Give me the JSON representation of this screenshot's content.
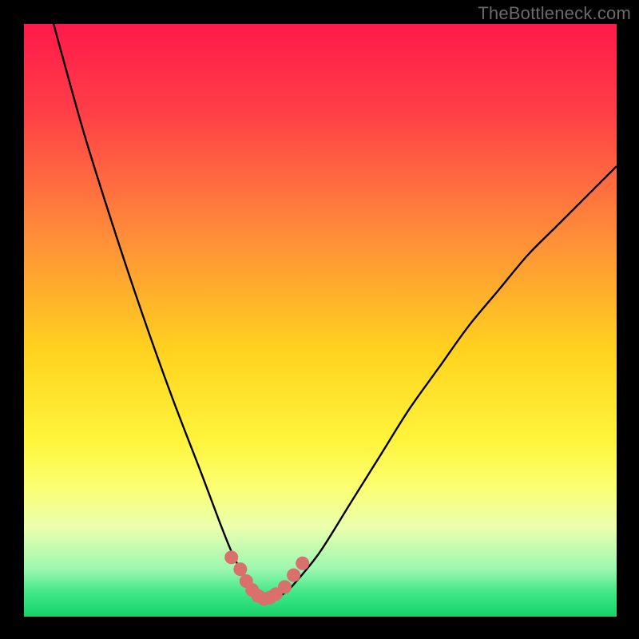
{
  "watermark": "TheBottleneck.com",
  "chart_data": {
    "type": "line",
    "title": "",
    "xlabel": "",
    "ylabel": "",
    "xlim": [
      0,
      100
    ],
    "ylim": [
      0,
      100
    ],
    "grid": false,
    "series": [
      {
        "name": "bottleneck-curve",
        "x": [
          5,
          10,
          15,
          20,
          25,
          30,
          33,
          35,
          37,
          39,
          40,
          42,
          44,
          46,
          50,
          55,
          60,
          65,
          70,
          75,
          80,
          85,
          90,
          95,
          100
        ],
        "y": [
          100,
          82,
          66,
          51,
          37,
          24,
          16,
          11,
          7,
          4,
          3,
          3,
          4,
          6,
          11,
          19,
          27,
          35,
          42,
          49,
          55,
          61,
          66,
          71,
          76
        ]
      }
    ],
    "markers": {
      "name": "highlight-dots",
      "x": [
        35,
        36.5,
        37.5,
        38.5,
        39.5,
        40.5,
        41.5,
        42.5,
        44,
        45.5,
        47
      ],
      "y": [
        10,
        8,
        6,
        4.5,
        3.5,
        3,
        3.2,
        3.8,
        5,
        7,
        9
      ]
    },
    "gradient_stops": [
      {
        "pos": 0.0,
        "color": "#ff1a4b"
      },
      {
        "pos": 0.15,
        "color": "#ff3f47"
      },
      {
        "pos": 0.35,
        "color": "#ff8a3a"
      },
      {
        "pos": 0.55,
        "color": "#ffd21f"
      },
      {
        "pos": 0.7,
        "color": "#fff43a"
      },
      {
        "pos": 0.78,
        "color": "#fcff70"
      },
      {
        "pos": 0.85,
        "color": "#eaffae"
      },
      {
        "pos": 0.92,
        "color": "#9cf7b0"
      },
      {
        "pos": 0.96,
        "color": "#3fe786"
      },
      {
        "pos": 1.0,
        "color": "#17d36a"
      }
    ]
  }
}
